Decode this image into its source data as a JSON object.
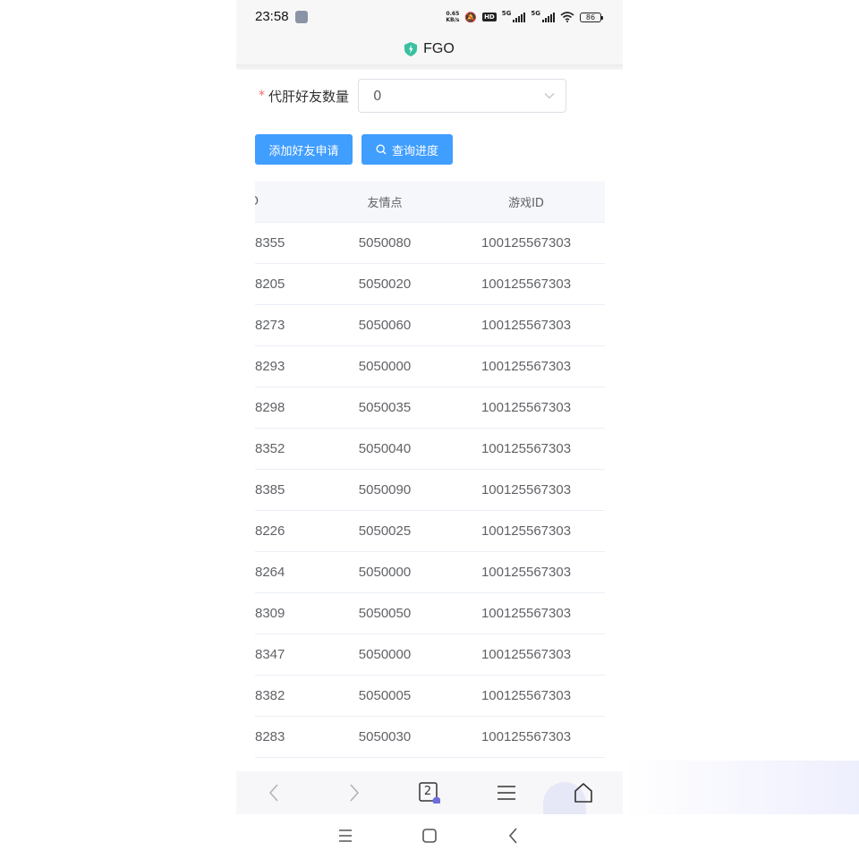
{
  "status_bar": {
    "time": "23:58",
    "net_speed_value": "0.65",
    "net_speed_unit": "KB/s",
    "hd_label": "HD",
    "net_type_1": "5G",
    "net_type_2": "5G",
    "battery": "86"
  },
  "title_bar": {
    "title": "FGO",
    "logo_color": "#3ac0a0"
  },
  "form": {
    "required_mark": "*",
    "friend_count_label": "代肝好友数量",
    "friend_count_value": "0"
  },
  "buttons": {
    "add_friend_request": "添加好友申请",
    "query_progress": "查询进度",
    "primary_color": "#409eff"
  },
  "table": {
    "headers": [
      "D",
      "友情点",
      "游戏ID"
    ],
    "rows": [
      [
        "8355",
        "5050080",
        "100125567303"
      ],
      [
        "8205",
        "5050020",
        "100125567303"
      ],
      [
        "8273",
        "5050060",
        "100125567303"
      ],
      [
        "8293",
        "5050000",
        "100125567303"
      ],
      [
        "8298",
        "5050035",
        "100125567303"
      ],
      [
        "8352",
        "5050040",
        "100125567303"
      ],
      [
        "8385",
        "5050090",
        "100125567303"
      ],
      [
        "8226",
        "5050025",
        "100125567303"
      ],
      [
        "8264",
        "5050000",
        "100125567303"
      ],
      [
        "8309",
        "5050050",
        "100125567303"
      ],
      [
        "8347",
        "5050000",
        "100125567303"
      ],
      [
        "8382",
        "5050005",
        "100125567303"
      ],
      [
        "8283",
        "5050030",
        "100125567303"
      ]
    ]
  },
  "browser_bar": {
    "tab_count": "2",
    "icons": [
      "back-icon",
      "forward-icon",
      "tabs-icon",
      "menu-icon",
      "home-icon"
    ]
  },
  "system_nav": {
    "icons": [
      "recent-apps-icon",
      "home-icon",
      "back-icon"
    ]
  }
}
